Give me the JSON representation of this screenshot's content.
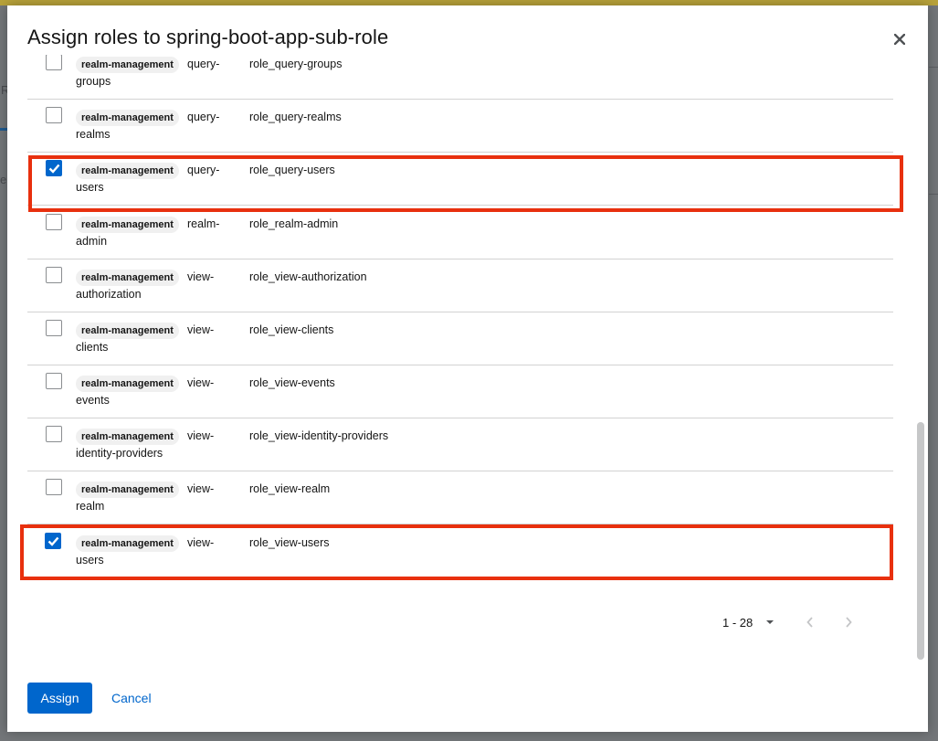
{
  "dialog": {
    "title": "Assign roles to spring-boot-app-sub-role",
    "close_icon": "close-icon"
  },
  "background": {
    "frag_r": "R",
    "frag_e": "e"
  },
  "roles": [
    {
      "client": "realm-management",
      "name_line1": "query-",
      "name_line2": "groups",
      "description": "role_query-groups",
      "checked": false
    },
    {
      "client": "realm-management",
      "name_line1": "query-",
      "name_line2": "realms",
      "description": "role_query-realms",
      "checked": false
    },
    {
      "client": "realm-management",
      "name_line1": "query-",
      "name_line2": "users",
      "description": "role_query-users",
      "checked": true
    },
    {
      "client": "realm-management",
      "name_line1": "realm-",
      "name_line2": "admin",
      "description": "role_realm-admin",
      "checked": false
    },
    {
      "client": "realm-management",
      "name_line1": "view-",
      "name_line2": "authorization",
      "description": "role_view-authorization",
      "checked": false
    },
    {
      "client": "realm-management",
      "name_line1": "view-",
      "name_line2": "clients",
      "description": "role_view-clients",
      "checked": false
    },
    {
      "client": "realm-management",
      "name_line1": "view-",
      "name_line2": "events",
      "description": "role_view-events",
      "checked": false
    },
    {
      "client": "realm-management",
      "name_line1": "view-",
      "name_line2": "identity-providers",
      "description": "role_view-identity-providers",
      "checked": false
    },
    {
      "client": "realm-management",
      "name_line1": "view-",
      "name_line2": "realm",
      "description": "role_view-realm",
      "checked": false
    },
    {
      "client": "realm-management",
      "name_line1": "view-",
      "name_line2": "users",
      "description": "role_view-users",
      "checked": true
    }
  ],
  "pagination": {
    "range_label": "1 - 28",
    "prev_icon": "chevron-left-icon",
    "next_icon": "chevron-right-icon",
    "toggle_icon": "caret-down-icon"
  },
  "footer": {
    "assign_label": "Assign",
    "cancel_label": "Cancel"
  },
  "colors": {
    "primary": "#0066cc",
    "highlight": "#e8300e"
  }
}
